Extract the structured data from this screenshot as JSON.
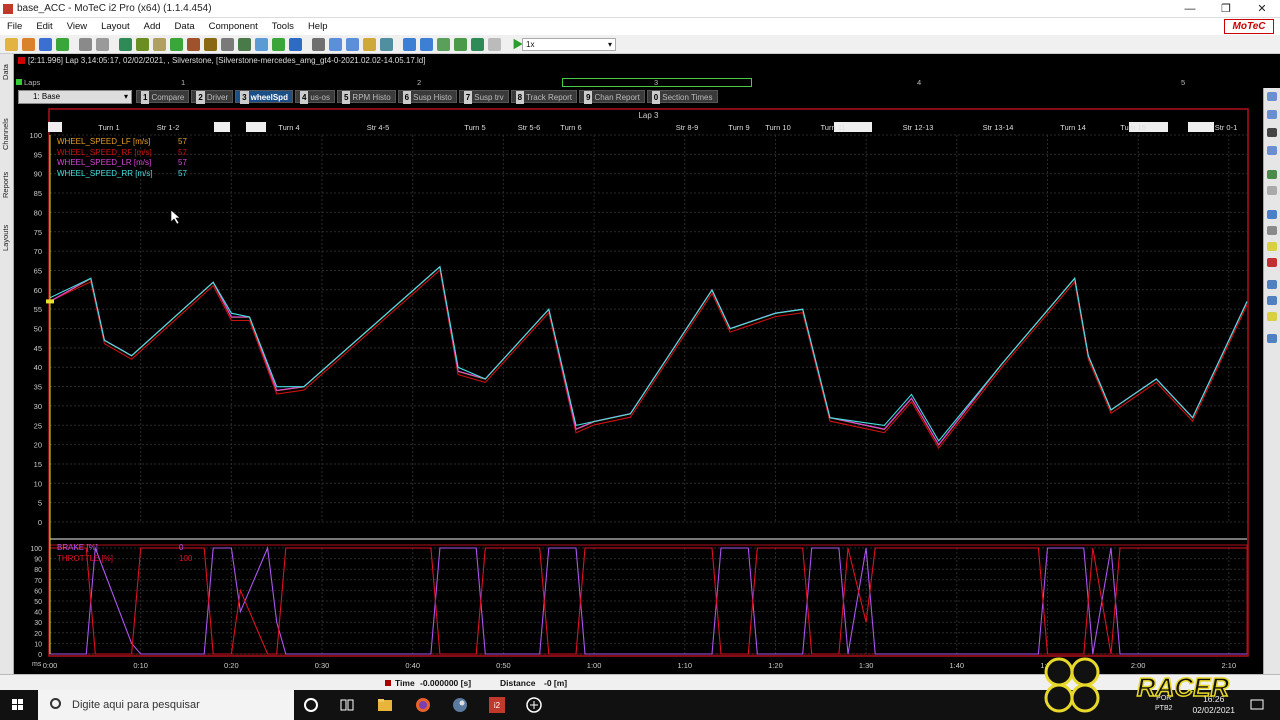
{
  "window": {
    "title": "base_ACC - MoTeC i2 Pro (x64) (1.1.4.454)",
    "minimize": "—",
    "maximize": "❐",
    "close": "✕",
    "brand": "MoTeC"
  },
  "menu": [
    "File",
    "Edit",
    "View",
    "Layout",
    "Add",
    "Data",
    "Component",
    "Tools",
    "Help"
  ],
  "toolbar": {
    "zoom_value": "1x"
  },
  "outing": {
    "info": "[2:11.996] Lap 3,14:05:17, 02/02/2021,  , Silverstone,  [Silverstone-mercedes_amg_gt4-0-2021.02.02-14.05.17.ld]"
  },
  "laps": {
    "label": "Laps",
    "numbers": [
      "1",
      "2",
      "3",
      "4",
      "5"
    ]
  },
  "workbook": {
    "selected": "1: Base",
    "tabs": [
      {
        "num": "1",
        "label": "Compare",
        "active": false
      },
      {
        "num": "2",
        "label": "Driver",
        "active": false
      },
      {
        "num": "3",
        "label": "wheelSpd",
        "active": true
      },
      {
        "num": "4",
        "label": "us-os",
        "active": false
      },
      {
        "num": "5",
        "label": "RPM Histo",
        "active": false
      },
      {
        "num": "6",
        "label": "Susp Histo",
        "active": false
      },
      {
        "num": "7",
        "label": "Susp trv",
        "active": false
      },
      {
        "num": "8",
        "label": "Track Report",
        "active": false
      },
      {
        "num": "9",
        "label": "Chan Report",
        "active": false
      },
      {
        "num": "0",
        "label": "Section Times",
        "active": false
      }
    ]
  },
  "left_tabs": [
    "Data",
    "Channels",
    "Reports",
    "Layouts"
  ],
  "graph": {
    "lap_title": "Lap 3",
    "sections": [
      "Turn 1",
      "Str 1-2",
      "Turn 4",
      "Str 4-5",
      "Turn 5",
      "Str 5-6",
      "Turn 6",
      "Str 8-9",
      "Turn 9",
      "Turn 10",
      "Turn 11",
      "Str 12-13",
      "Str 13-14",
      "Turn 14",
      "Turn 15",
      "Str 0-1"
    ],
    "y_ticks_top": [
      "100",
      "95",
      "90",
      "85",
      "80",
      "75",
      "70",
      "65",
      "60",
      "55",
      "50",
      "45",
      "40",
      "35",
      "30",
      "25",
      "20",
      "15",
      "10",
      "5",
      "0"
    ],
    "y_ticks_bottom": [
      "100",
      "90",
      "80",
      "70",
      "60",
      "50",
      "40",
      "30",
      "20",
      "10",
      "0"
    ],
    "x_unit": "ms",
    "x_ticks": [
      "0:00",
      "0:10",
      "0:20",
      "0:30",
      "0:40",
      "0:50",
      "1:00",
      "1:10",
      "1:20",
      "1:30",
      "1:40",
      "1:50",
      "2:00",
      "2:10"
    ],
    "legend_top": [
      {
        "name": "WHEEL_SPEED_LF [m/s]",
        "value": "57",
        "color": "#e8a020"
      },
      {
        "name": "WHEEL_SPEED_RF [m/s]",
        "value": "57",
        "color": "#cc1111"
      },
      {
        "name": "WHEEL_SPEED_LR [m/s]",
        "value": "57",
        "color": "#dd44dd"
      },
      {
        "name": "WHEEL_SPEED_RR [m/s]",
        "value": "57",
        "color": "#44e0e0"
      }
    ],
    "legend_bottom": [
      {
        "name": "BRAKE [%]",
        "value": "0",
        "color": "#aa55ee"
      },
      {
        "name": "THROTTLE [%]",
        "value": "100",
        "color": "#dd1122"
      }
    ]
  },
  "chart_data": [
    {
      "type": "line",
      "xlabel": "",
      "ylabel": "",
      "xlim": [
        0,
        132
      ],
      "ylim": [
        0,
        100
      ],
      "x": [
        0,
        4.5,
        6,
        9,
        18,
        20,
        22,
        25,
        28,
        43,
        45,
        48,
        55,
        58,
        60,
        64,
        73,
        75,
        80,
        83,
        86,
        92,
        95,
        98,
        105,
        113,
        114.5,
        117,
        122,
        126,
        132
      ],
      "series": [
        {
          "name": "WHEEL_SPEED_LF [m/s]",
          "values": [
            57,
            63,
            47,
            43,
            62,
            53,
            53,
            34,
            35,
            66,
            39,
            37,
            55,
            24,
            26,
            28,
            60,
            50,
            54,
            55,
            27,
            24,
            32,
            20,
            41,
            63,
            43,
            29,
            37,
            27,
            57
          ]
        },
        {
          "name": "WHEEL_SPEED_RF [m/s]",
          "values": [
            57,
            62,
            46,
            42,
            61,
            52,
            52,
            33,
            34,
            65,
            38,
            36,
            54,
            23,
            25,
            27,
            59,
            49,
            53,
            54,
            26,
            23,
            31,
            19,
            40,
            62,
            42,
            28,
            36,
            26,
            56
          ]
        },
        {
          "name": "WHEEL_SPEED_LR [m/s]",
          "values": [
            57,
            63,
            47,
            43,
            62,
            53,
            53,
            34,
            35,
            66,
            39,
            37,
            55,
            24,
            26,
            28,
            60,
            50,
            54,
            55,
            27,
            24,
            32,
            20,
            41,
            63,
            43,
            29,
            37,
            27,
            57
          ]
        },
        {
          "name": "WHEEL_SPEED_RR [m/s]",
          "values": [
            58,
            63,
            47,
            43,
            62,
            54,
            53,
            35,
            35,
            66,
            40,
            37,
            55,
            25,
            26,
            28,
            60,
            50,
            54,
            55,
            27,
            25,
            33,
            21,
            41,
            63,
            43,
            29,
            37,
            27,
            57
          ]
        }
      ]
    },
    {
      "type": "line",
      "xlabel": "",
      "ylabel": "",
      "xlim": [
        0,
        132
      ],
      "ylim": [
        0,
        100
      ],
      "x": [
        0,
        4,
        5,
        9,
        10,
        17,
        18,
        20,
        21,
        24,
        25,
        26,
        42,
        43,
        47,
        48,
        54,
        55,
        58,
        59,
        73,
        74,
        77,
        78,
        83,
        84,
        87,
        88,
        90,
        91,
        98,
        109,
        110,
        114,
        115,
        117,
        118,
        132
      ],
      "series": [
        {
          "name": "BRAKE [%]",
          "values": [
            0,
            0,
            100,
            10,
            0,
            0,
            100,
            100,
            40,
            100,
            30,
            0,
            0,
            100,
            100,
            0,
            0,
            100,
            100,
            0,
            0,
            100,
            100,
            0,
            0,
            100,
            100,
            0,
            100,
            0,
            0,
            0,
            100,
            100,
            0,
            100,
            0,
            0
          ]
        },
        {
          "name": "THROTTLE [%]",
          "values": [
            100,
            100,
            0,
            0,
            100,
            100,
            0,
            0,
            60,
            0,
            0,
            100,
            100,
            0,
            0,
            100,
            100,
            0,
            0,
            100,
            100,
            0,
            0,
            100,
            100,
            0,
            0,
            100,
            30,
            100,
            100,
            100,
            0,
            0,
            100,
            0,
            100,
            100
          ]
        }
      ]
    }
  ],
  "status": {
    "time_label": "Time",
    "time_value": "-0.000000 [s]",
    "distance_label": "Distance",
    "distance_value": "-0 [m]"
  },
  "taskbar": {
    "search_placeholder": "Digite aqui para pesquisar",
    "lang1": "POR",
    "lang2": "PTB2",
    "time": "16:26",
    "date": "02/02/2021",
    "watermark": "RACER"
  }
}
